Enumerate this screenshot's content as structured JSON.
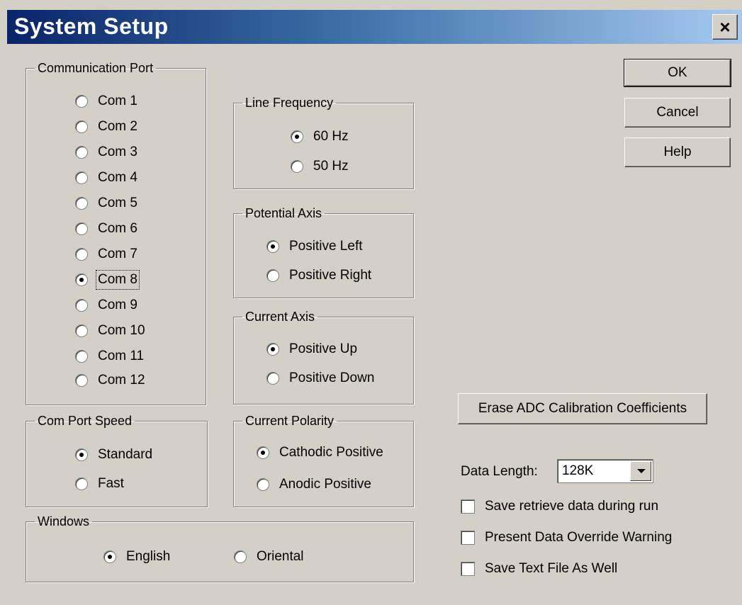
{
  "window": {
    "title": "System Setup",
    "close_label": "×"
  },
  "buttons": {
    "ok": "OK",
    "cancel": "Cancel",
    "help": "Help",
    "erase": "Erase ADC Calibration Coefficients"
  },
  "comm_port": {
    "legend": "Communication Port",
    "options": [
      "Com 1",
      "Com 2",
      "Com 3",
      "Com 4",
      "Com 5",
      "Com 6",
      "Com 7",
      "Com 8",
      "Com 9",
      "Com 10",
      "Com 11",
      "Com 12"
    ],
    "selected": "Com 8"
  },
  "line_frequency": {
    "legend": "Line Frequency",
    "options": [
      "60 Hz",
      "50 Hz"
    ],
    "selected": "60 Hz"
  },
  "potential_axis": {
    "legend": "Potential Axis",
    "options": [
      "Positive Left",
      "Positive Right"
    ],
    "selected": "Positive Left"
  },
  "current_axis": {
    "legend": "Current Axis",
    "options": [
      "Positive Up",
      "Positive Down"
    ],
    "selected": "Positive Up"
  },
  "current_polarity": {
    "legend": "Current Polarity",
    "options": [
      "Cathodic Positive",
      "Anodic Positive"
    ],
    "selected": "Cathodic Positive"
  },
  "com_speed": {
    "legend": "Com Port Speed",
    "options": [
      "Standard",
      "Fast"
    ],
    "selected": "Standard"
  },
  "windows_lang": {
    "legend": "Windows",
    "options": [
      "English",
      "Oriental"
    ],
    "selected": "English"
  },
  "data_length": {
    "label": "Data Length:",
    "value": "128K"
  },
  "checkboxes": [
    {
      "label": "Save retrieve data during run",
      "checked": false
    },
    {
      "label": "Present Data Override Warning",
      "checked": false
    },
    {
      "label": "Save Text File As Well",
      "checked": false
    }
  ]
}
